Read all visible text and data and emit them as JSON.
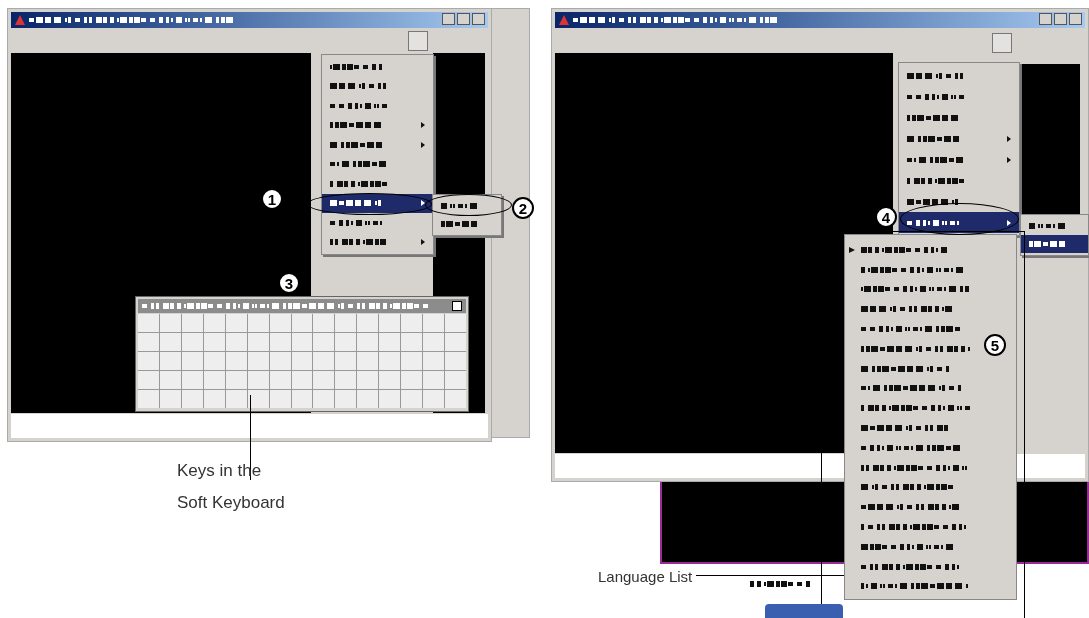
{
  "left_window": {
    "menu": {
      "items": [
        {
          "selected": false,
          "has_submenu": false
        },
        {
          "selected": false,
          "has_submenu": false
        },
        {
          "selected": false,
          "has_submenu": false
        },
        {
          "selected": false,
          "has_submenu": true
        },
        {
          "selected": false,
          "has_submenu": true
        },
        {
          "selected": false,
          "has_submenu": false
        },
        {
          "selected": false,
          "has_submenu": false
        },
        {
          "selected": true,
          "has_submenu": true
        },
        {
          "selected": false,
          "has_submenu": false
        },
        {
          "selected": false,
          "has_submenu": true
        }
      ]
    },
    "submenu": {
      "items": [
        {
          "selected": false
        },
        {
          "selected": false
        }
      ]
    }
  },
  "right_window": {
    "menu": {
      "items": [
        {
          "selected": false,
          "has_submenu": false
        },
        {
          "selected": false,
          "has_submenu": false
        },
        {
          "selected": false,
          "has_submenu": false
        },
        {
          "selected": false,
          "has_submenu": true
        },
        {
          "selected": false,
          "has_submenu": true
        },
        {
          "selected": false,
          "has_submenu": false
        },
        {
          "selected": false,
          "has_submenu": false
        },
        {
          "selected": true,
          "has_submenu": true
        }
      ]
    },
    "submenu": {
      "items": [
        {
          "selected": false
        },
        {
          "selected": true
        }
      ]
    },
    "language_list": {
      "items": [
        {
          "checked": true
        },
        {
          "checked": false
        },
        {
          "checked": false
        },
        {
          "checked": false
        },
        {
          "checked": false
        },
        {
          "checked": false
        },
        {
          "checked": false
        },
        {
          "checked": false
        },
        {
          "checked": false
        },
        {
          "checked": false
        },
        {
          "checked": false
        },
        {
          "checked": false
        },
        {
          "checked": false
        },
        {
          "checked": false
        },
        {
          "checked": false
        },
        {
          "checked": false
        },
        {
          "checked": false
        },
        {
          "checked": false
        }
      ]
    }
  },
  "callouts": [
    {
      "label": "1"
    },
    {
      "label": "2"
    },
    {
      "label": "3"
    },
    {
      "label": "4"
    },
    {
      "label": "5"
    }
  ],
  "captions": {
    "keyboard": [
      "Keys in the",
      "Soft Keyboard"
    ],
    "language_list": "Language List"
  }
}
